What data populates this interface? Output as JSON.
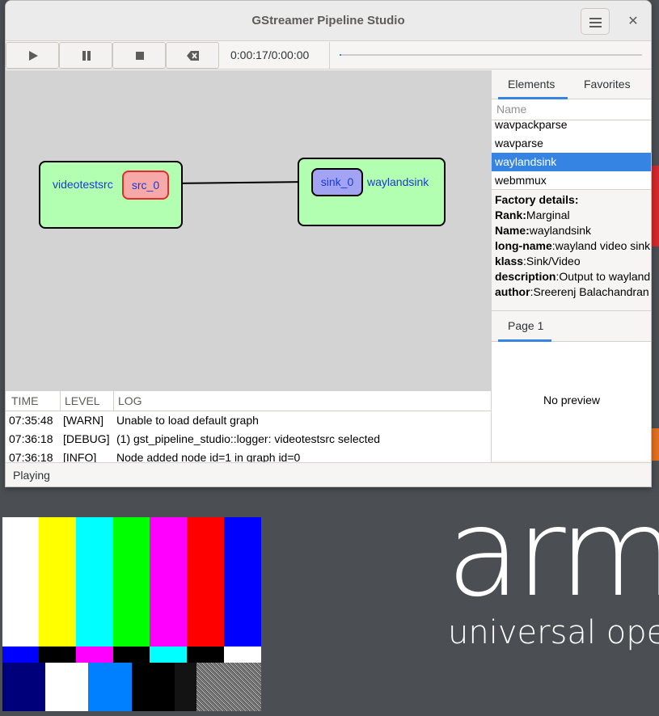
{
  "window": {
    "title": "GStreamer Pipeline Studio"
  },
  "toolbar": {
    "play_icon": "play-icon",
    "pause_icon": "pause-icon",
    "stop_icon": "stop-icon",
    "clear_icon": "clear-icon",
    "time": "0:00:17/0:00:00",
    "seek_progress": 0.005
  },
  "graph": {
    "nodes": [
      {
        "name": "videotestsrc",
        "pad": "src_0"
      },
      {
        "name": "waylandsink",
        "pad": "sink_0"
      }
    ]
  },
  "log": {
    "columns": [
      "TIME",
      "LEVEL",
      "LOG"
    ],
    "rows": [
      {
        "time": "07:35:48",
        "level": "[WARN]",
        "msg": "Unable to load default graph"
      },
      {
        "time": "07:36:18",
        "level": "[DEBUG]",
        "msg": "(1) gst_pipeline_studio::logger: videotestsrc selected"
      },
      {
        "time": "07:36:18",
        "level": "[INFO]",
        "msg": "Node added node id=1 in graph id=0"
      }
    ]
  },
  "sidebar": {
    "tabs": [
      "Elements",
      "Favorites"
    ],
    "name_header": "Name",
    "elements": [
      "wavpackparse",
      "wavparse",
      "waylandsink",
      "webmmux"
    ],
    "selected": "waylandsink",
    "details": {
      "heading": "Factory details:",
      "rank_label": "Rank:",
      "rank": "Marginal",
      "name_label": "Name:",
      "name": "waylandsink",
      "longname_label": "long-name",
      "longname": ":wayland video sink",
      "klass_label": "klass",
      "klass": ":Sink/Video",
      "description_label": "description",
      "description": ":Output to wayland surface",
      "author_label": "author",
      "author": ":Sreerenj Balachandran"
    },
    "page_tab": "Page 1",
    "preview": "No preview"
  },
  "status": {
    "text": "Playing"
  },
  "desktop": {
    "logo": "arm",
    "tagline": "universal oper"
  },
  "colors": {
    "accent": "#3584e4",
    "node_fill": "#b2ffb2",
    "src_pad": "#f7a9a9",
    "sink_pad": "#a3a3f4"
  }
}
